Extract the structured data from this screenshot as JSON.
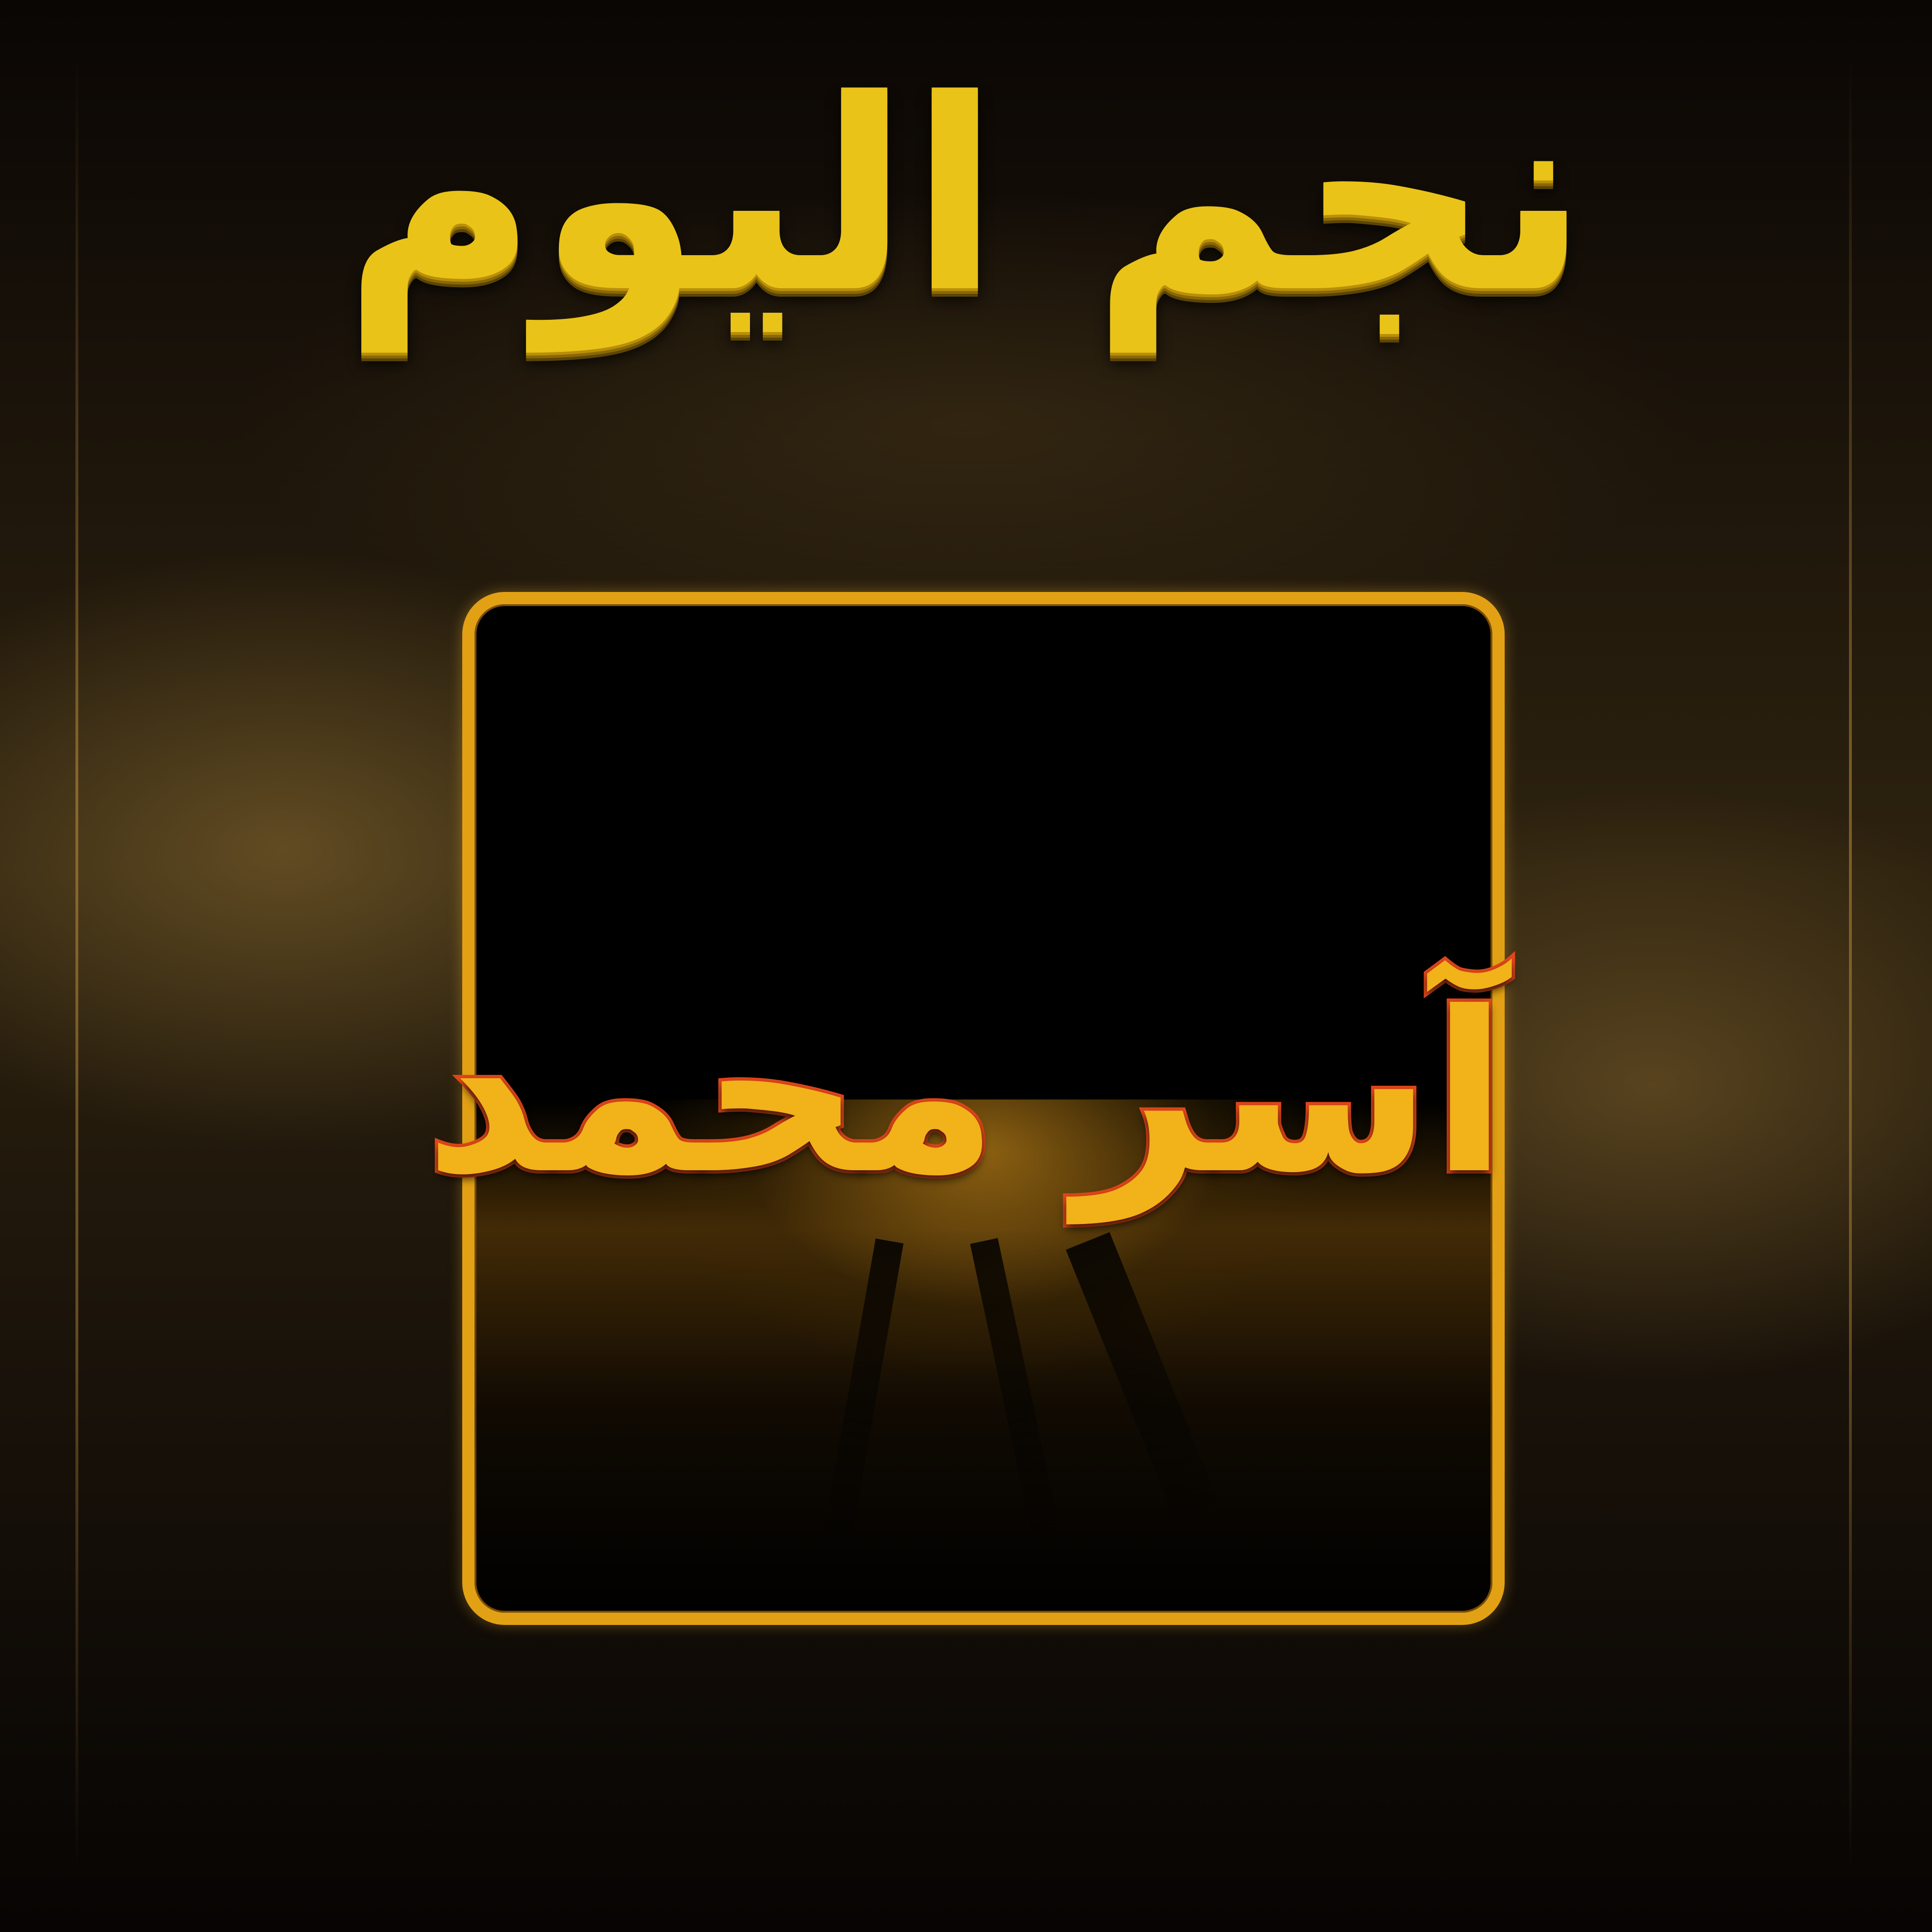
{
  "header": {
    "title": "نجم اليوم"
  },
  "card": {
    "name": "آسر محمد"
  },
  "colors": {
    "gold": "#e9c318",
    "frame_gold": "#e2a114",
    "name_fill": "#f2b21a",
    "name_outline": "#e2471a",
    "background": "#0b0704",
    "frame_interior": "#000000"
  }
}
